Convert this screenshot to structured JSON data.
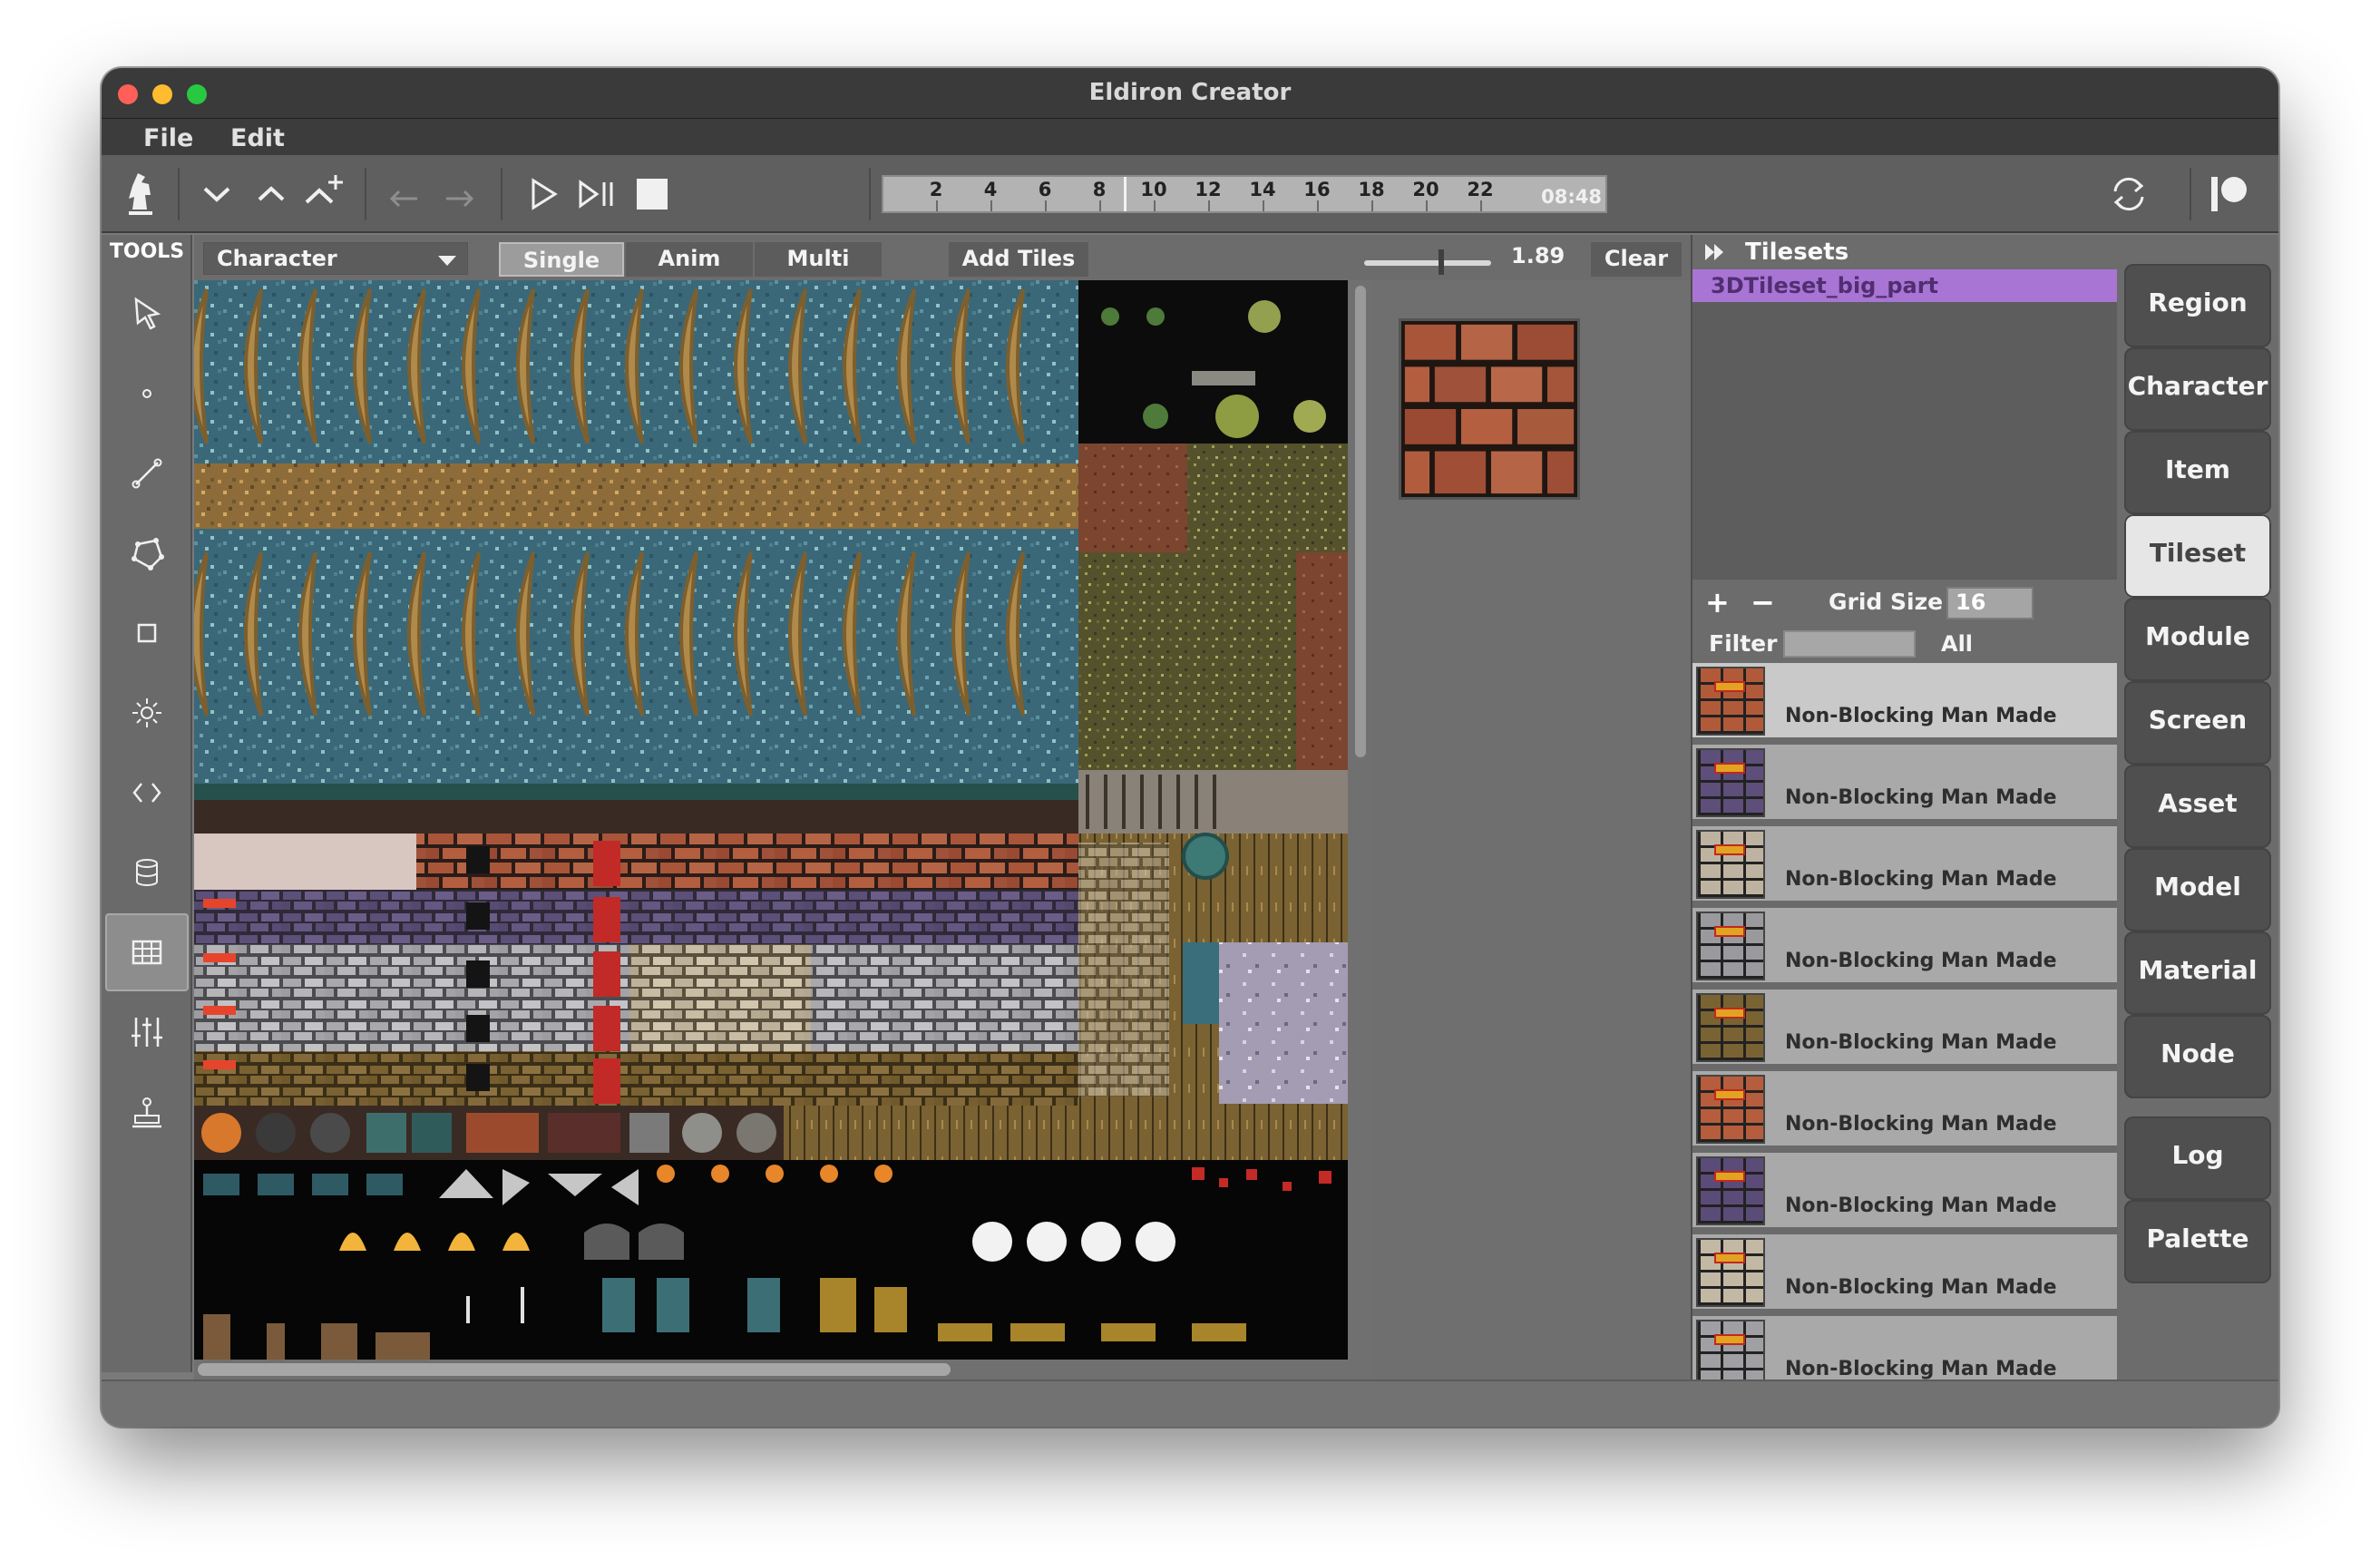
{
  "window": {
    "title": "Eldiron Creator"
  },
  "menu": [
    "File",
    "Edit"
  ],
  "timeline": {
    "ticks": [
      "2",
      "4",
      "6",
      "8",
      "10",
      "12",
      "14",
      "16",
      "18",
      "20",
      "22"
    ],
    "time": "08:48"
  },
  "tools": {
    "label": "TOOLS"
  },
  "subbar": {
    "mode": "Character",
    "segments": [
      "Single",
      "Anim",
      "Multi"
    ],
    "selected_segment": "Single",
    "add_tiles": "Add Tiles",
    "zoom": "1.89",
    "clear": "Clear"
  },
  "tilesets": {
    "header": "Tilesets",
    "items": [
      "3DTileset_big_part"
    ],
    "grid_size_label": "Grid Size",
    "grid_size": "16",
    "filter_label": "Filter",
    "filter_value": "",
    "filter_select": "All"
  },
  "tile_list": [
    {
      "tags": "Non-Blocking  Man Made",
      "selected": true,
      "swatch": "#b05a3a"
    },
    {
      "tags": "Non-Blocking  Man Made",
      "selected": false,
      "swatch": "#5e4e7a"
    },
    {
      "tags": "Non-Blocking  Man Made",
      "selected": false,
      "swatch": "#bdb3a0"
    },
    {
      "tags": "Non-Blocking  Man Made",
      "selected": false,
      "swatch": "#9a9a9e"
    },
    {
      "tags": "Non-Blocking  Man Made",
      "selected": false,
      "swatch": "#7a6332"
    },
    {
      "tags": "Non-Blocking  Man Made",
      "selected": false,
      "swatch": "#b55d3c"
    },
    {
      "tags": "Non-Blocking  Man Made",
      "selected": false,
      "swatch": "#5b4b78"
    },
    {
      "tags": "Non-Blocking  Man Made",
      "selected": false,
      "swatch": "#c2b8a4"
    },
    {
      "tags": "Non-Blocking  Man Made",
      "selected": false,
      "swatch": "#a0a0a4"
    }
  ],
  "sidebar": [
    "Region",
    "Character",
    "Item",
    "Tileset",
    "Module",
    "Screen",
    "Asset",
    "Model",
    "Material",
    "Node",
    "Log",
    "Palette"
  ],
  "sidebar_active": "Tileset",
  "colors": {
    "accent_selection": "#a875d4",
    "water": "#3c6e7e",
    "sand": "#b08a4a",
    "brick": "#a5553a"
  }
}
